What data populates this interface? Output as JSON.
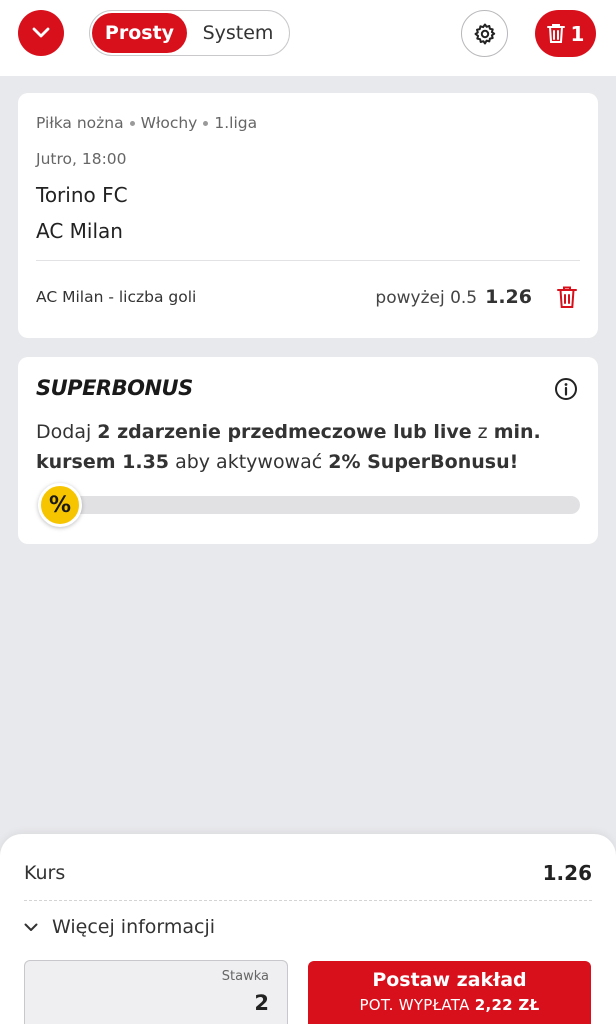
{
  "header": {
    "mode_active": "Prosty",
    "mode_inactive": "System",
    "bet_count": "1"
  },
  "selection": {
    "sport": "Piłka nożna",
    "country": "Włochy",
    "league": "1.liga",
    "time": "Jutro, 18:00",
    "team_home": "Torino FC",
    "team_away": "AC Milan",
    "market": "AC Milan - liczba goli",
    "pick": "powyżej 0.5",
    "odds": "1.26"
  },
  "superbonus": {
    "logo": "SUPERBONUS",
    "text_1": "Dodaj ",
    "text_2": "2 zdarzenie przedmeczowe lub live",
    "text_3": " z ",
    "text_4": "min. kursem 1.35",
    "text_5": " aby aktywować ",
    "text_6": "2% SuperBonusu!",
    "badge": "%",
    "progress": 0
  },
  "footer": {
    "kurs_label": "Kurs",
    "kurs_value": "1.26",
    "more_info": "Więcej informacji",
    "stake_label": "Stawka",
    "stake_value": "2",
    "place_bet": "Postaw zakład",
    "payout_label": "POT. WYPŁATA ",
    "payout_value": "2,22 ZŁ"
  },
  "colors": {
    "accent": "#d8101c",
    "bonus_yellow": "#f7c500",
    "background": "#e8e9ec"
  }
}
